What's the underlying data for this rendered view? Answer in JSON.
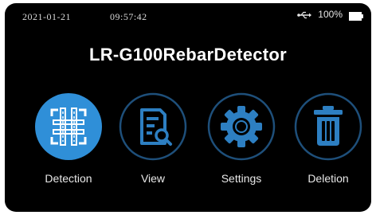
{
  "status": {
    "date": "2021-01-21",
    "time": "09:57:42",
    "battery": "100%",
    "icons": [
      "usb-icon",
      "battery-icon"
    ]
  },
  "title": "LR-G100RebarDetector",
  "menu": {
    "selected": "Detection",
    "items": [
      {
        "label": "Detection",
        "icon": "rebar-grid-icon"
      },
      {
        "label": "View",
        "icon": "document-search-icon"
      },
      {
        "label": "Settings",
        "icon": "gear-icon"
      },
      {
        "label": "Deletion",
        "icon": "trash-icon"
      }
    ]
  },
  "colors": {
    "accent": "#2f8fd8",
    "icon_ring": "#1e4f7a",
    "icon_blue": "#2d7fc2",
    "background": "#000000"
  }
}
